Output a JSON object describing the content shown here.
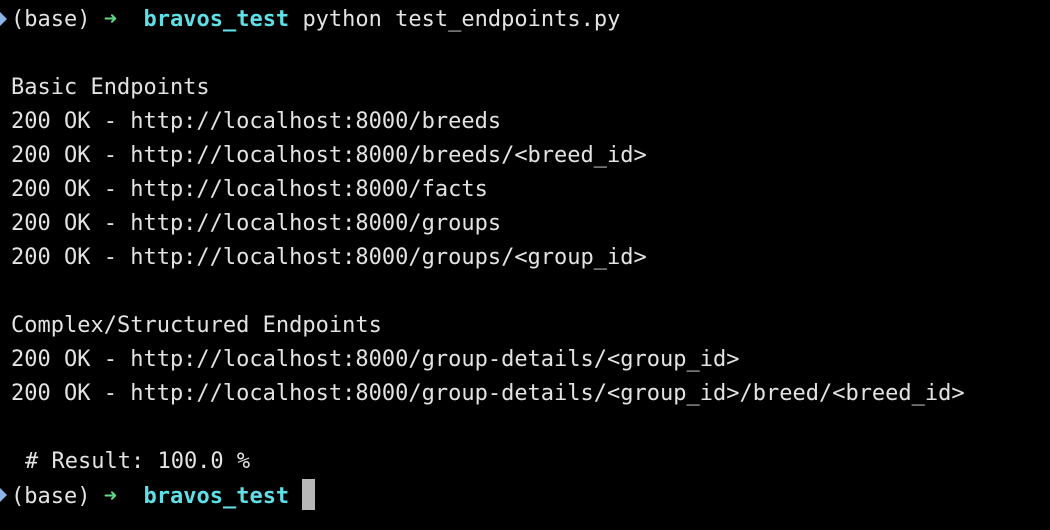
{
  "terminal": {
    "prompt1": {
      "env": "(base)",
      "arrow": "➜",
      "dir": "bravos_test",
      "command": "python test_endpoints.py"
    },
    "output": {
      "section1_title": "Basic Endpoints",
      "section1_lines": [
        "200 OK - http://localhost:8000/breeds",
        "200 OK - http://localhost:8000/breeds/<breed_id>",
        "200 OK - http://localhost:8000/facts",
        "200 OK - http://localhost:8000/groups",
        "200 OK - http://localhost:8000/groups/<group_id>"
      ],
      "section2_title": "Complex/Structured Endpoints",
      "section2_lines": [
        "200 OK - http://localhost:8000/group-details/<group_id>",
        "200 OK - http://localhost:8000/group-details/<group_id>/breed/<breed_id>"
      ],
      "result": "# Result: 100.0 %"
    },
    "prompt2": {
      "env": "(base)",
      "arrow": "➜",
      "dir": "bravos_test"
    }
  }
}
